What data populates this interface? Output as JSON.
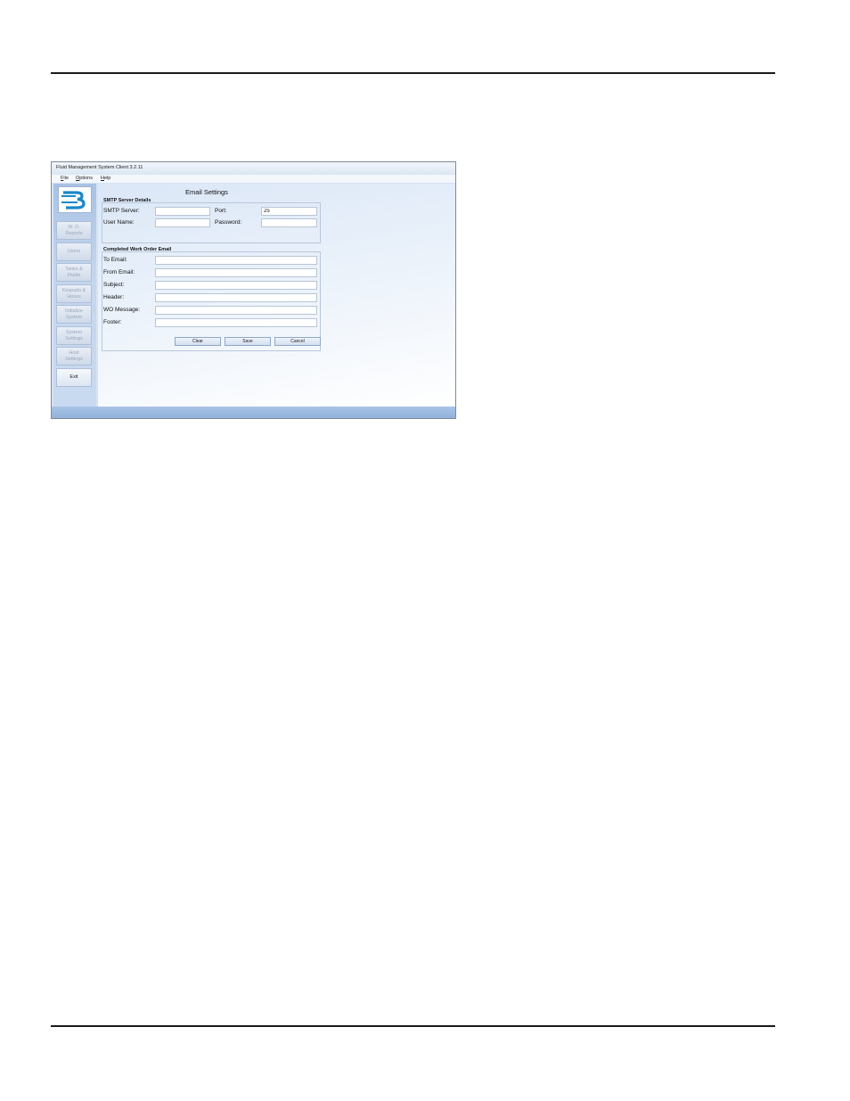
{
  "window": {
    "title": "Fluid Management System Client 3.2.11"
  },
  "menu": [
    {
      "accel": "F",
      "rest": "ile"
    },
    {
      "accel": "O",
      "rest": "ptions"
    },
    {
      "accel": "H",
      "rest": "elp"
    }
  ],
  "sidebar": {
    "logo_icon": "bb-logo-icon",
    "buttons": [
      {
        "label": "W. O.\nReports",
        "enabled": false
      },
      {
        "label": "Users",
        "enabled": false
      },
      {
        "label": "Tanks &\nFluids",
        "enabled": false
      },
      {
        "label": "Keypads &\nHoses",
        "enabled": false
      },
      {
        "label": "Initialize\nSystem",
        "enabled": false
      },
      {
        "label": "System\nSettings",
        "enabled": false
      },
      {
        "label": "Host\nSettings",
        "enabled": false
      },
      {
        "label": "Exit",
        "enabled": true
      }
    ]
  },
  "form": {
    "heading": "Email Settings",
    "smtp": {
      "title": "SMTP Server Details",
      "server_label": "SMTP Server:",
      "server_value": "",
      "port_label": "Port:",
      "port_value": "25",
      "user_label": "User Name:",
      "user_value": "",
      "password_label": "Password:",
      "password_value": ""
    },
    "completed": {
      "title": "Completed Work Order Email",
      "to_label": "To Email:",
      "from_label": "From Email:",
      "subject_label": "Subject:",
      "header_label": "Header:",
      "message_label": "WO Message:",
      "footer_label": "Footer:"
    },
    "buttons": {
      "clear": "Clear",
      "save": "Save",
      "cancel": "Cancel"
    }
  },
  "colors": {
    "accent": "#1a87c9",
    "sidebar_bg": "#c4d6ee",
    "statusbar": "#8fb0da"
  }
}
